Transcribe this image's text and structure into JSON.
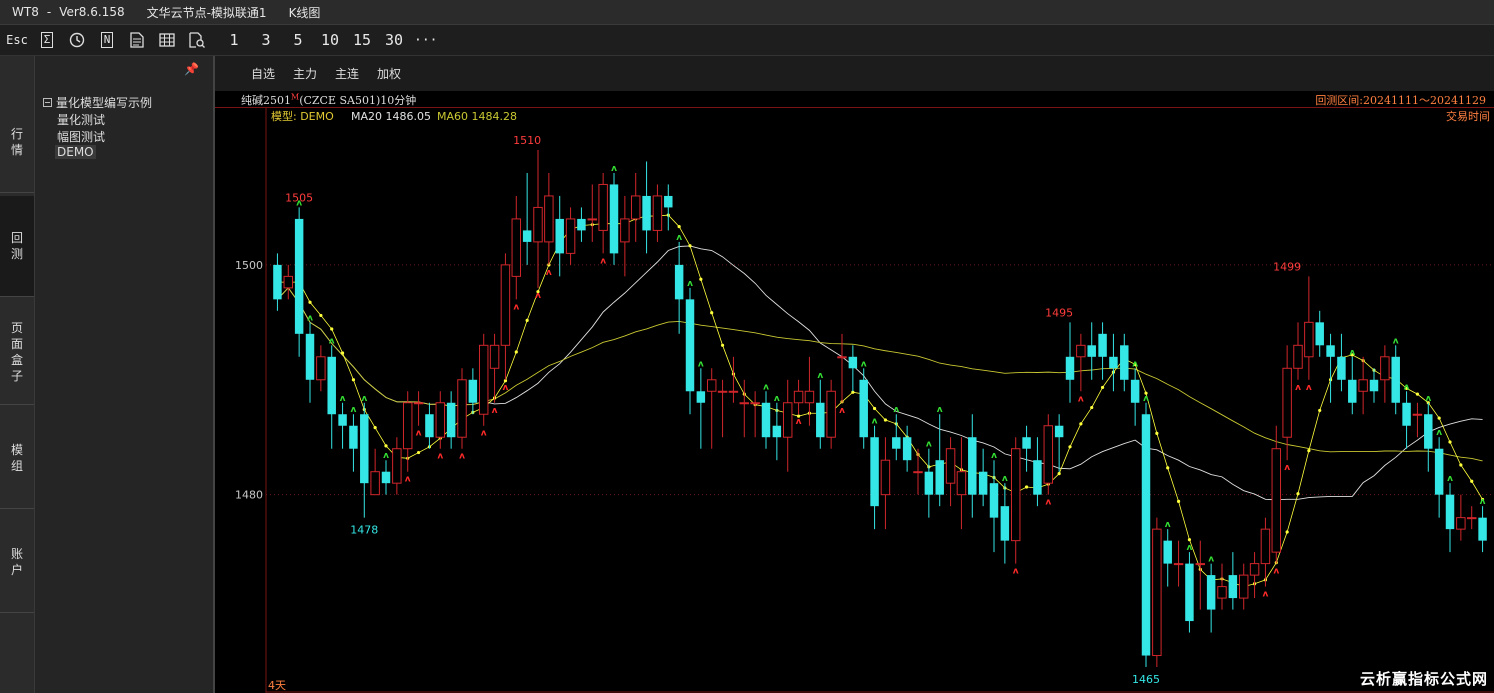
{
  "window": {
    "app": "WT8",
    "dash": "-",
    "version": "Ver8.6.158",
    "node": "文华云节点-模拟联通1",
    "view": "K线图"
  },
  "toolbar": {
    "esc": "Esc",
    "sigma": "Σ",
    "n": "N",
    "periods": [
      "1",
      "3",
      "5",
      "10",
      "15",
      "30"
    ],
    "more": "···"
  },
  "sidebar_tabs": [
    "行\n情",
    "回\n测",
    "页\n面\n盒\n子",
    "模\n组",
    "账\n户"
  ],
  "tree": {
    "pin": "📌",
    "root": "量化模型编写示例",
    "items": [
      "量化测试",
      "幅图测试",
      "DEMO"
    ]
  },
  "chart_tabs": [
    "自选",
    "主力",
    "主连",
    "加权"
  ],
  "info": {
    "symbol": "纯碱2501",
    "mark": "M",
    "code": "(CZCE SA501)10分钟",
    "range": "回测区间:20241111～20241129"
  },
  "legend": {
    "model": "模型: DEMO",
    "ma20": "MA20 1486.05",
    "ma60": "MA60 1484.28",
    "trade_time": "交易时间"
  },
  "footer": {
    "days": "4天"
  },
  "watermark": "云析赢指标公式网",
  "colors": {
    "up": "#d0262b",
    "down": "#35e6e6",
    "ma_white": "#e0e0e0",
    "ma_yellow": "#c8c832",
    "dots": "#ffff3c",
    "buy_signal": "#33dd33",
    "sell_signal": "#ff2a2a",
    "axis_label": "#c8c8c8",
    "legend_model": "#e0c832"
  },
  "chart_data": {
    "type": "candlestick",
    "y_ticks": [
      1500,
      1480
    ],
    "ylim": [
      1463,
      1512
    ],
    "annotations": [
      {
        "label": "1505",
        "index": 2,
        "value": 1505,
        "kind": "high"
      },
      {
        "label": "1510",
        "index": 23,
        "value": 1510,
        "kind": "high"
      },
      {
        "label": "1478",
        "index": 8,
        "value": 1478,
        "kind": "low"
      },
      {
        "label": "1495",
        "index": 72,
        "value": 1495,
        "kind": "high"
      },
      {
        "label": "1465",
        "index": 80,
        "value": 1465,
        "kind": "low"
      },
      {
        "label": "1499",
        "index": 93,
        "value": 1499,
        "kind": "high"
      }
    ],
    "candles": [
      [
        1500,
        1497,
        1501,
        1496
      ],
      [
        1498,
        1499,
        1500,
        1497
      ],
      [
        1504,
        1494,
        1505,
        1492
      ],
      [
        1494,
        1490,
        1495,
        1488
      ],
      [
        1490,
        1492,
        1493,
        1489
      ],
      [
        1492,
        1487,
        1493,
        1484
      ],
      [
        1487,
        1486,
        1488,
        1484
      ],
      [
        1486,
        1484,
        1487,
        1482
      ],
      [
        1487,
        1481,
        1488,
        1478
      ],
      [
        1480,
        1482,
        1484,
        1480
      ],
      [
        1482,
        1481,
        1483,
        1480
      ],
      [
        1481,
        1484,
        1485,
        1480
      ],
      [
        1484,
        1488,
        1489,
        1482
      ],
      [
        1488,
        1488,
        1489,
        1486
      ],
      [
        1487,
        1485,
        1488,
        1484
      ],
      [
        1485,
        1488,
        1489,
        1484
      ],
      [
        1488,
        1485,
        1489,
        1484
      ],
      [
        1485,
        1490,
        1491,
        1484
      ],
      [
        1490,
        1488,
        1491,
        1487
      ],
      [
        1487,
        1493,
        1494,
        1486
      ],
      [
        1491,
        1493,
        1494,
        1488
      ],
      [
        1493,
        1500,
        1501,
        1490
      ],
      [
        1499,
        1504,
        1506,
        1497
      ],
      [
        1503,
        1502,
        1508,
        1500
      ],
      [
        1502,
        1505,
        1510,
        1498
      ],
      [
        1502,
        1506,
        1508,
        1500
      ],
      [
        1504,
        1501,
        1506,
        1499
      ],
      [
        1501,
        1504,
        1505,
        1500
      ],
      [
        1504,
        1503,
        1505,
        1502
      ],
      [
        1504,
        1504,
        1507,
        1502
      ],
      [
        1503,
        1507,
        1508,
        1501
      ],
      [
        1507,
        1501,
        1508,
        1500
      ],
      [
        1502,
        1504,
        1506,
        1499
      ],
      [
        1504,
        1506,
        1508,
        1502
      ],
      [
        1506,
        1503,
        1509,
        1501
      ],
      [
        1503,
        1506,
        1507,
        1502
      ],
      [
        1506,
        1505,
        1507,
        1503
      ],
      [
        1500,
        1497,
        1502,
        1494
      ],
      [
        1497,
        1489,
        1498,
        1487
      ],
      [
        1489,
        1488,
        1491,
        1484
      ],
      [
        1489,
        1490,
        1491,
        1484
      ],
      [
        1489,
        1489,
        1490,
        1485
      ],
      [
        1489,
        1489,
        1492,
        1488
      ],
      [
        1488,
        1488,
        1490,
        1485
      ],
      [
        1488,
        1488,
        1489,
        1485
      ],
      [
        1488,
        1485,
        1489,
        1484
      ],
      [
        1486,
        1485,
        1488,
        1483
      ],
      [
        1485,
        1488,
        1490,
        1482
      ],
      [
        1488,
        1489,
        1490,
        1487
      ],
      [
        1488,
        1489,
        1492,
        1486
      ],
      [
        1488,
        1485,
        1490,
        1484
      ],
      [
        1485,
        1489,
        1490,
        1484
      ],
      [
        1492,
        1492,
        1494,
        1488
      ],
      [
        1492,
        1491,
        1493,
        1489
      ],
      [
        1490,
        1485,
        1491,
        1484
      ],
      [
        1485,
        1479,
        1486,
        1477
      ],
      [
        1480,
        1483,
        1485,
        1477
      ],
      [
        1485,
        1484,
        1487,
        1483
      ],
      [
        1485,
        1483,
        1486,
        1482
      ],
      [
        1482,
        1482,
        1484,
        1480
      ],
      [
        1482,
        1480,
        1484,
        1478
      ],
      [
        1483,
        1480,
        1487,
        1479
      ],
      [
        1481,
        1484,
        1485,
        1479
      ],
      [
        1480,
        1482,
        1485,
        1477
      ],
      [
        1485,
        1480,
        1487,
        1478
      ],
      [
        1482,
        1480,
        1484,
        1479
      ],
      [
        1481,
        1478,
        1483,
        1475
      ],
      [
        1479,
        1476,
        1481,
        1474
      ],
      [
        1476,
        1484,
        1485,
        1474
      ],
      [
        1485,
        1484,
        1486,
        1482
      ],
      [
        1483,
        1480,
        1485,
        1479
      ],
      [
        1481,
        1486,
        1487,
        1480
      ],
      [
        1486,
        1485,
        1487,
        1482
      ],
      [
        1492,
        1490,
        1495,
        1488
      ],
      [
        1492,
        1493,
        1494,
        1489
      ],
      [
        1493,
        1492,
        1495,
        1490
      ],
      [
        1494,
        1492,
        1495,
        1490
      ],
      [
        1492,
        1491,
        1494,
        1489
      ],
      [
        1493,
        1490,
        1494,
        1489
      ],
      [
        1490,
        1488,
        1491,
        1486
      ],
      [
        1487,
        1466,
        1488,
        1465
      ],
      [
        1466,
        1477,
        1478,
        1465
      ],
      [
        1476,
        1474,
        1477,
        1472
      ],
      [
        1474,
        1474,
        1476,
        1472
      ],
      [
        1474,
        1469,
        1475,
        1468
      ],
      [
        1474,
        1474,
        1476,
        1470
      ],
      [
        1473,
        1470,
        1474,
        1468
      ],
      [
        1471,
        1472,
        1474,
        1470
      ],
      [
        1473,
        1471,
        1475,
        1470
      ],
      [
        1471,
        1473,
        1474,
        1470
      ],
      [
        1473,
        1474,
        1475,
        1471
      ],
      [
        1474,
        1477,
        1478,
        1472
      ],
      [
        1475,
        1484,
        1486,
        1474
      ],
      [
        1485,
        1491,
        1493,
        1483
      ],
      [
        1491,
        1493,
        1495,
        1490
      ],
      [
        1492,
        1495,
        1499,
        1490
      ],
      [
        1495,
        1493,
        1496,
        1492
      ],
      [
        1493,
        1492,
        1494,
        1488
      ],
      [
        1492,
        1490,
        1494,
        1489
      ],
      [
        1490,
        1488,
        1492,
        1487
      ],
      [
        1489,
        1490,
        1492,
        1487
      ],
      [
        1490,
        1489,
        1491,
        1488
      ],
      [
        1490,
        1492,
        1493,
        1488
      ],
      [
        1492,
        1488,
        1493,
        1487
      ],
      [
        1488,
        1486,
        1489,
        1484
      ],
      [
        1487,
        1487,
        1488,
        1485
      ],
      [
        1487,
        1484,
        1488,
        1482
      ],
      [
        1484,
        1480,
        1485,
        1478
      ],
      [
        1480,
        1477,
        1481,
        1475
      ],
      [
        1477,
        1478,
        1480,
        1476
      ],
      [
        1478,
        1478,
        1479,
        1477
      ],
      [
        1478,
        1476,
        1479,
        1475
      ]
    ]
  }
}
